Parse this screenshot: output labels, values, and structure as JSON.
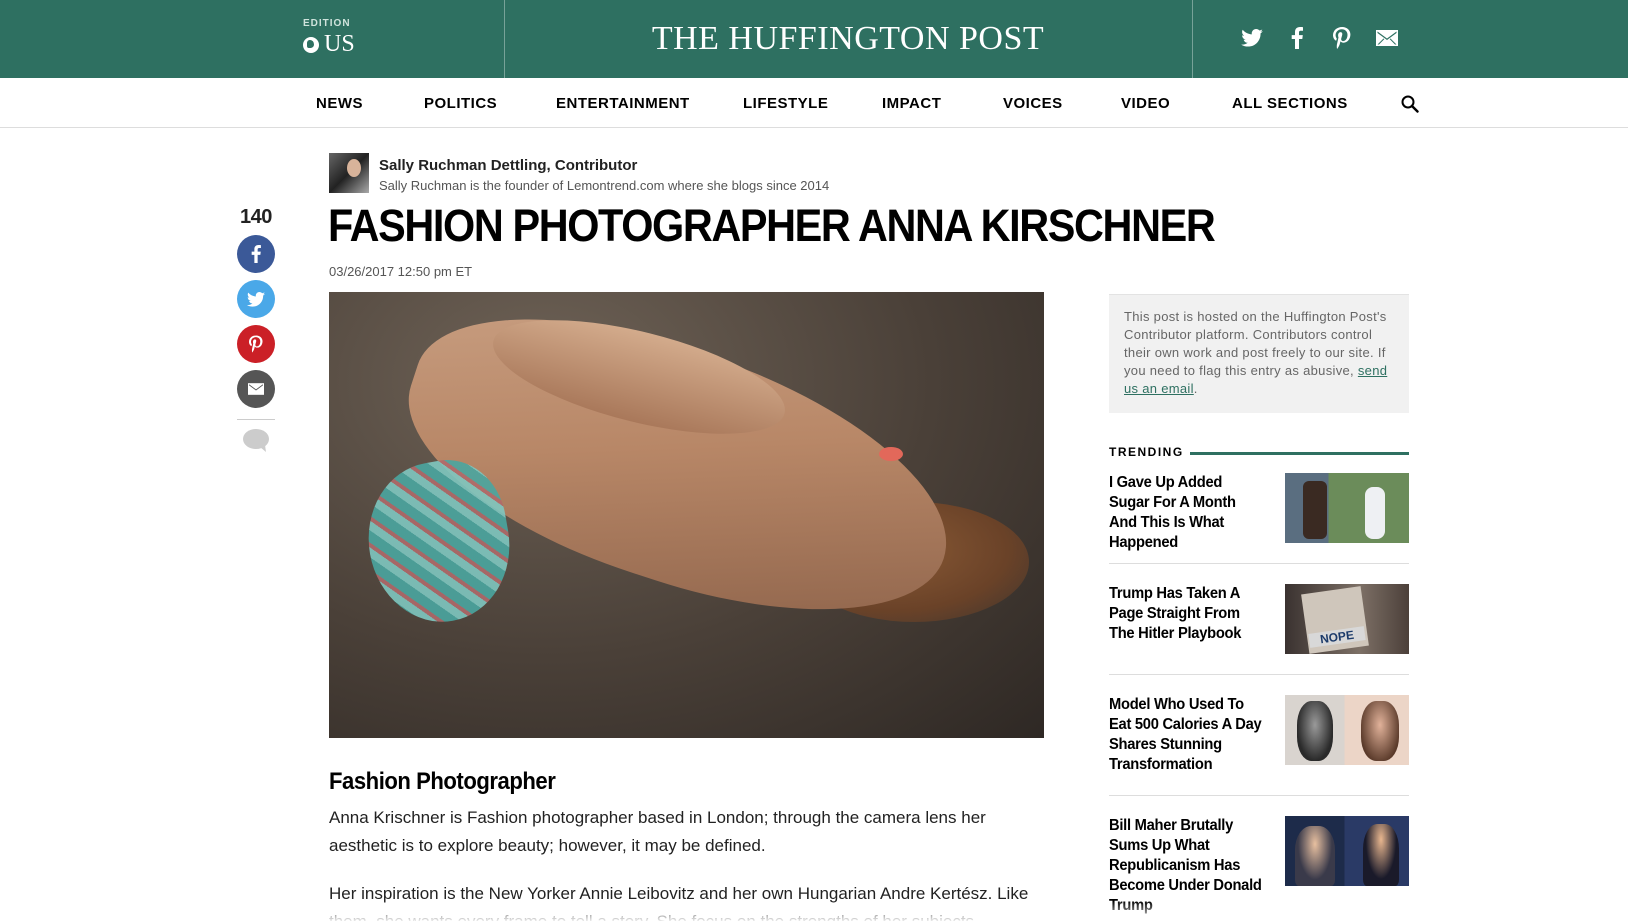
{
  "header": {
    "edition_label": "EDITION",
    "edition_value": "US",
    "logo": "THE HUFFINGTON POST",
    "social": [
      "twitter-icon",
      "facebook-icon",
      "pinterest-icon",
      "email-icon"
    ],
    "brand_color": "#2e7061"
  },
  "nav": {
    "items": [
      "NEWS",
      "POLITICS",
      "ENTERTAINMENT",
      "LIFESTYLE",
      "IMPACT",
      "VOICES",
      "VIDEO",
      "ALL SECTIONS"
    ]
  },
  "author": {
    "name": "Sally Ruchman Dettling, Contributor",
    "bio": "Sally Ruchman is the founder of Lemontrend.com where she blogs since 2014"
  },
  "share": {
    "count": "140",
    "colors": {
      "facebook": "#3b5998",
      "twitter": "#4aa8e8",
      "pinterest": "#cb2027",
      "email": "#555555"
    }
  },
  "article": {
    "headline": "FASHION PHOTOGRAPHER ANNA KIRSCHNER",
    "timestamp": "03/26/2017 12:50 pm ET",
    "subheading": "Fashion Photographer",
    "para1": "Anna Krischner is Fashion photographer based in London; through the camera lens her aesthetic is to explore beauty; however, it may be defined.",
    "para2": "Her inspiration is the New Yorker Annie Leibovitz and her own Hungarian Andre Kertész. Like them, she wants every frame to tell a story. She focus on the strengths of her subjects"
  },
  "sidebar": {
    "notice_text": "This post is hosted on the Huffington Post's Contributor platform. Contributors control their own work and post freely to our site. If you need to flag this entry as abusive,",
    "notice_link": "send us an email",
    "trending_label": "TRENDING",
    "trending": [
      {
        "title": "I Gave Up Added Sugar For A Month And This Is What Happened"
      },
      {
        "title": "Trump Has Taken A Page Straight From The Hitler Playbook",
        "thumb_text": "NOPE"
      },
      {
        "title": "Model Who Used To Eat 500 Calories A Day Shares Stunning Transformation"
      },
      {
        "title": "Bill Maher Brutally Sums Up What Republicanism Has Become Under Donald Trump"
      }
    ]
  }
}
